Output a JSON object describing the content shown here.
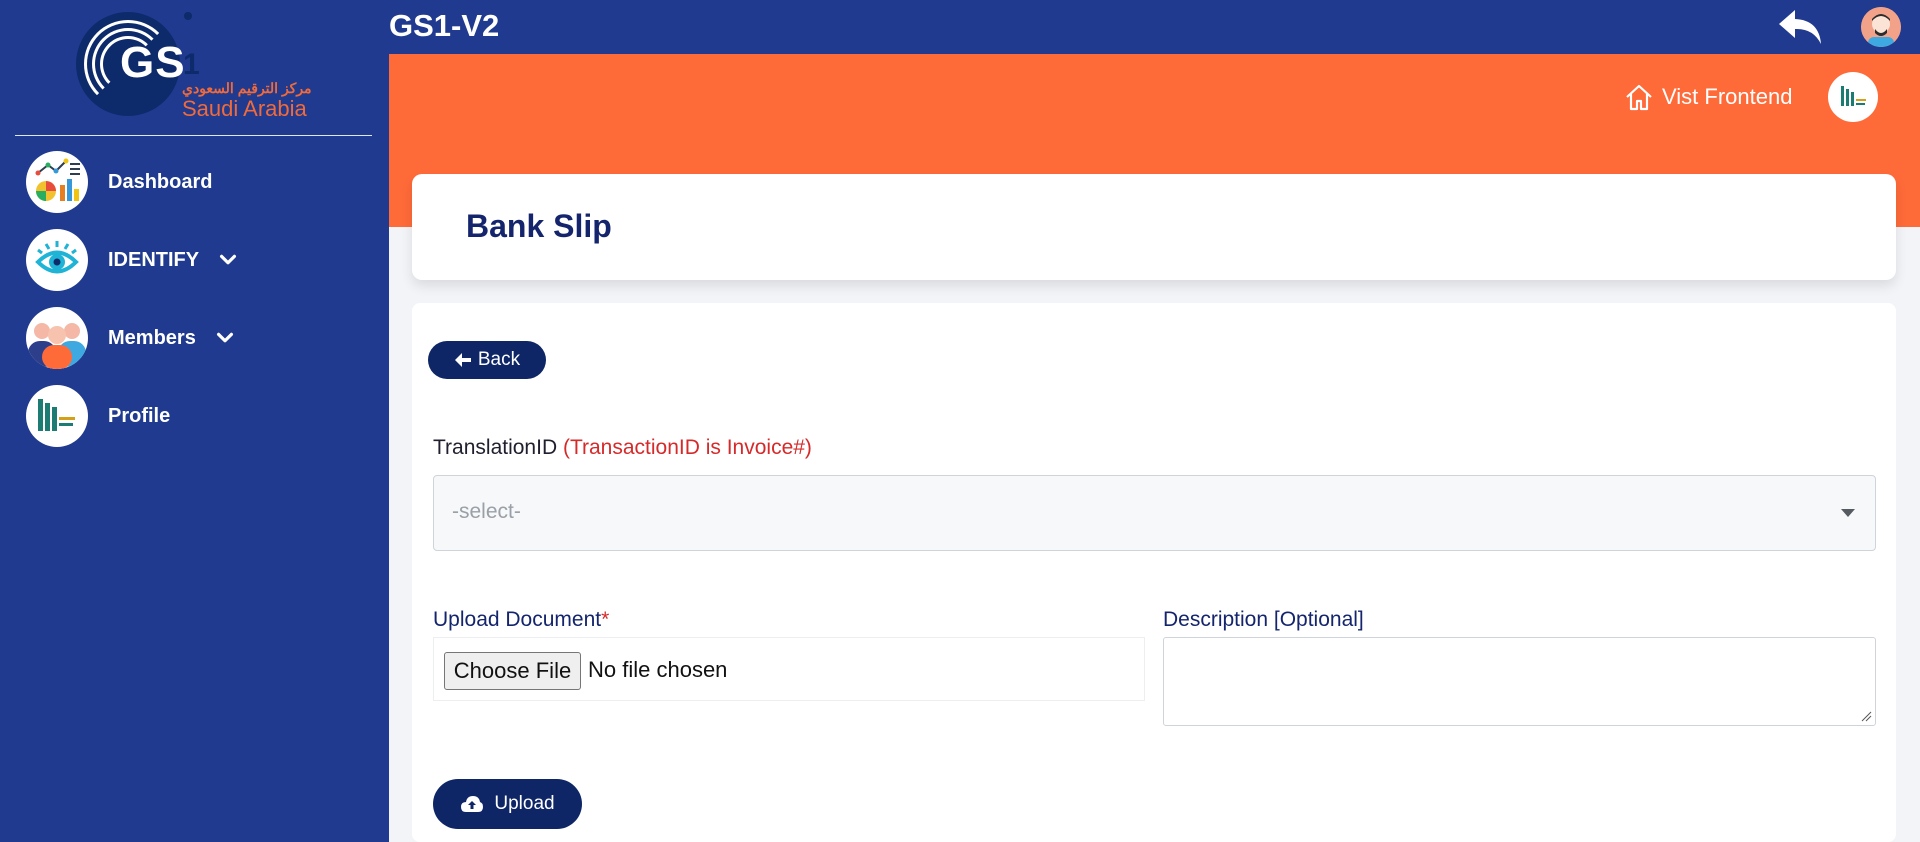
{
  "app": {
    "title": "GS1-V2"
  },
  "logo": {
    "text": "GS",
    "one": "1",
    "arabic": "مركز الترقيم السعودي",
    "region": "Saudi Arabia"
  },
  "sidebar": {
    "items": [
      {
        "label": "Dashboard",
        "icon": "dashboard-charts-icon",
        "has_submenu": false
      },
      {
        "label": "IDENTIFY",
        "icon": "eye-icon",
        "has_submenu": true
      },
      {
        "label": "Members",
        "icon": "people-group-icon",
        "has_submenu": true
      },
      {
        "label": "Profile",
        "icon": "company-building-logo-icon",
        "has_submenu": false
      }
    ]
  },
  "topbar": {
    "reply_icon": "reply-arrow-icon",
    "avatar_icon": "user-avatar-icon"
  },
  "header": {
    "visit_frontend_label": "Vist Frontend",
    "home_icon": "home-icon",
    "company_logo_icon": "company-logo-icon"
  },
  "page": {
    "title": "Bank Slip"
  },
  "form": {
    "back_label": "Back",
    "translation_label": "TranslationID",
    "translation_hint": "(TransactionID is Invoice#)",
    "select_placeholder": "-select-",
    "upload_label": "Upload Document",
    "upload_required_mark": "*",
    "choose_file_label": "Choose File",
    "file_status": "No file chosen",
    "description_label": "Description [Optional]",
    "description_value": "",
    "upload_button_label": "Upload"
  },
  "colors": {
    "sidebar": "#1f3a8e",
    "accent_orange": "#ff6a39",
    "navy_button": "#0e2566",
    "title_text": "#15256d",
    "hint_red": "#d62a2a"
  }
}
